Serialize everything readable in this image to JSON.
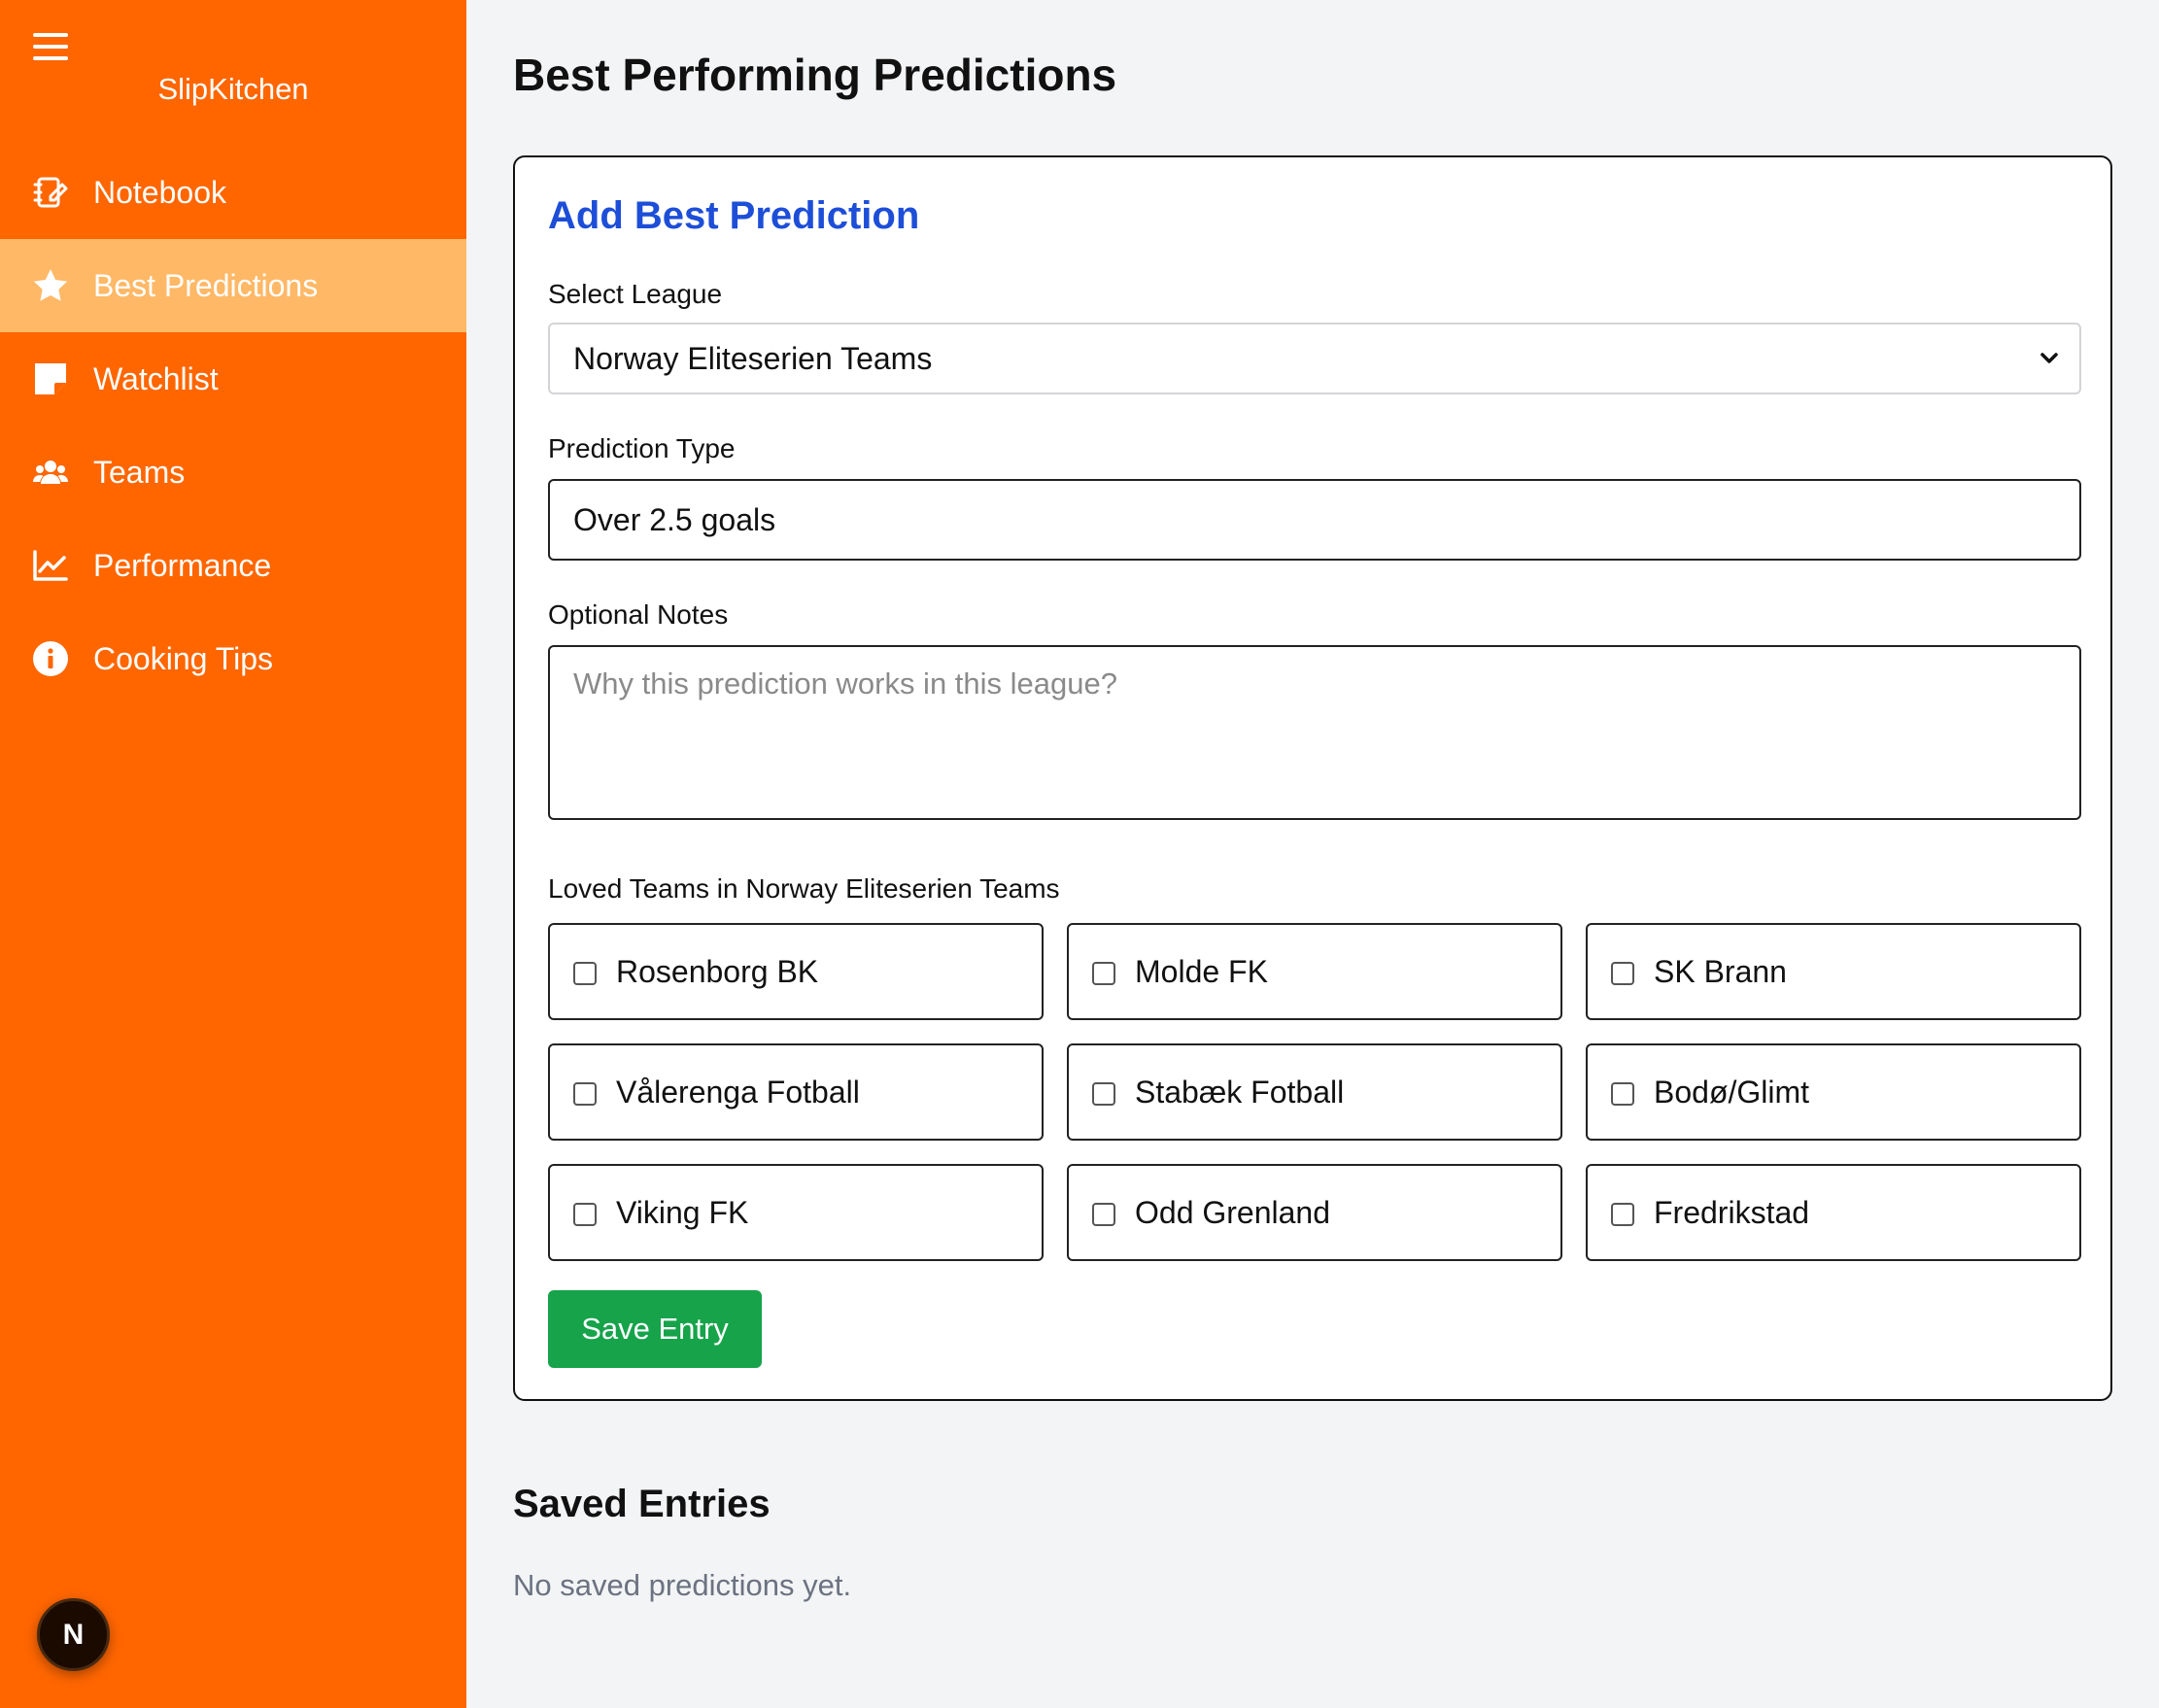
{
  "sidebar": {
    "brand": "SlipKitchen",
    "items": [
      {
        "label": "Notebook",
        "icon": "notebook-icon",
        "active": false
      },
      {
        "label": "Best Predictions",
        "icon": "star-icon",
        "active": true
      },
      {
        "label": "Watchlist",
        "icon": "sticky-note-icon",
        "active": false
      },
      {
        "label": "Teams",
        "icon": "users-icon",
        "active": false
      },
      {
        "label": "Performance",
        "icon": "chart-line-icon",
        "active": false
      },
      {
        "label": "Cooking Tips",
        "icon": "info-icon",
        "active": false
      }
    ],
    "avatar_letter": "N"
  },
  "page": {
    "title": "Best Performing Predictions"
  },
  "form": {
    "title": "Add Best Prediction",
    "league_label": "Select League",
    "league_value": "Norway Eliteserien Teams",
    "prediction_label": "Prediction Type",
    "prediction_value": "Over 2.5 goals",
    "notes_label": "Optional Notes",
    "notes_placeholder": "Why this prediction works in this league?",
    "teams_label": "Loved Teams in Norway Eliteserien Teams",
    "teams": [
      {
        "name": "Rosenborg BK",
        "checked": false
      },
      {
        "name": "Molde FK",
        "checked": false
      },
      {
        "name": "SK Brann",
        "checked": false
      },
      {
        "name": "Vålerenga Fotball",
        "checked": false
      },
      {
        "name": "Stabæk Fotball",
        "checked": false
      },
      {
        "name": "Bodø/Glimt",
        "checked": false
      },
      {
        "name": "Viking FK",
        "checked": false
      },
      {
        "name": "Odd Grenland",
        "checked": false
      },
      {
        "name": "Fredrikstad",
        "checked": false
      }
    ],
    "save_label": "Save Entry"
  },
  "saved": {
    "title": "Saved Entries",
    "empty_text": "No saved predictions yet."
  },
  "colors": {
    "sidebar": "#ff6600",
    "active_item": "#ffb866",
    "card_title": "#1d4ed8",
    "save_button": "#16a34a"
  }
}
